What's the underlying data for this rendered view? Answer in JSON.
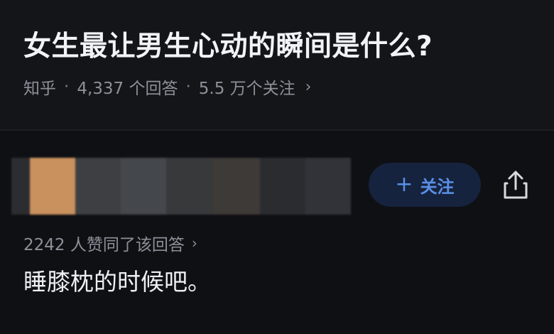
{
  "question": {
    "title": "女生最让男生心动的瞬间是什么?",
    "source": "知乎",
    "separator": "·",
    "answers_count": "4,337 个回答",
    "followers": "5.5 万个关注",
    "chevron": "›"
  },
  "answer": {
    "follow_plus": "+",
    "follow_label": "关注",
    "share_icon": "share-icon",
    "upvote_text": "2242 人赞同了该回答",
    "upvote_chevron": "›",
    "body": "睡膝枕的时候吧。"
  },
  "colors": {
    "background": "#111217",
    "accent": "#5a8fe8",
    "follow_bg": "#16233e",
    "muted_text": "#8e9099"
  }
}
